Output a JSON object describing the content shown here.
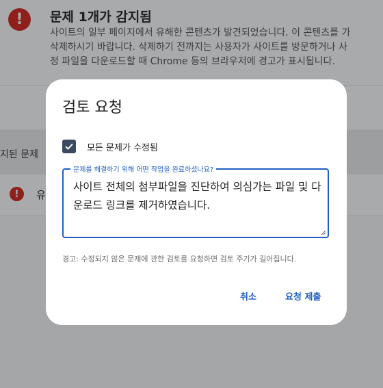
{
  "background": {
    "issue_title": "문제 1개가 감지됨",
    "issue_desc_lines": [
      "사이트의 일부 페이지에서 유해한 콘텐츠가 발견되었습니다. 이 콘텐츠를 가",
      "삭제하시기 바랍니다. 삭제하기 전까지는 사용자가 사이트를 방문하거나 사",
      "정 파일을 다운로드할 때 Chrome 등의 브라우저에 경고가 표시됩니다."
    ],
    "section_label": "지된 문제",
    "row_label": "유",
    "alert_glyph": "!"
  },
  "dialog": {
    "title": "검토 요청",
    "checkbox_label": "모든 문제가 수정됨",
    "checkbox_checked": true,
    "field_label": "문제를 해결하기 위해 어떤 작업을 완료하셨나요?",
    "field_value": "사이트 전체의 첨부파일을 진단하여 의심가는 파일 및 다운로드 링크를 제거하였습니다.",
    "hint": "경고: 수정되지 않은 문제에 관한 검토를 요청하면 검토 주기가 길어집니다.",
    "cancel_label": "취소",
    "submit_label": "요청 제출"
  },
  "colors": {
    "accent": "#1f5fc2",
    "alert": "#8f1f1a",
    "checkbox": "#3b4a5e",
    "scrim": "#a5a6a8"
  },
  "icons": {
    "issue": "alert-circle-icon",
    "check": "check-icon"
  }
}
